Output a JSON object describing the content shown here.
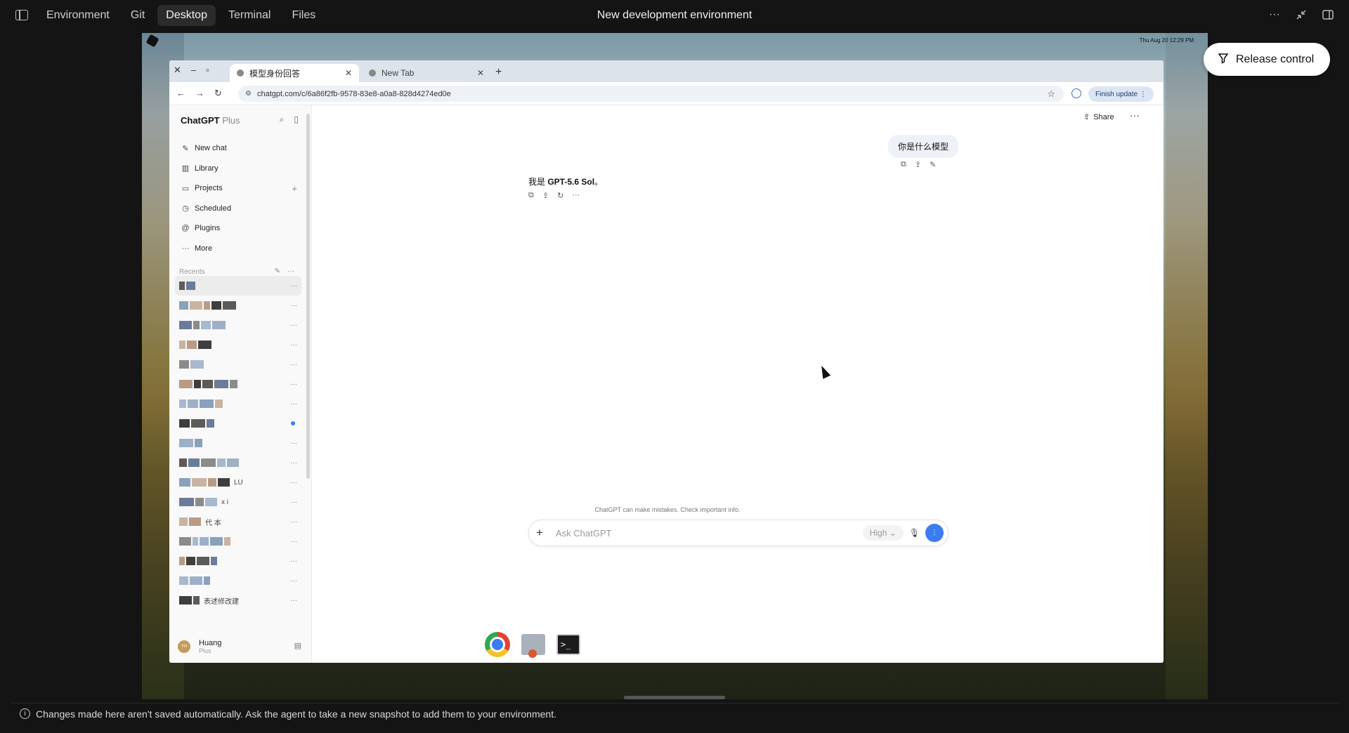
{
  "topbar": {
    "tabs": [
      {
        "label": "Environment"
      },
      {
        "label": "Git"
      },
      {
        "label": "Desktop"
      },
      {
        "label": "Terminal"
      },
      {
        "label": "Files"
      }
    ],
    "title": "New development environment",
    "more": "···",
    "collapse_icon": "collapse-icon",
    "panel_icon": "panel-icon"
  },
  "release": {
    "label": "Release control",
    "icon": "filter-icon"
  },
  "desktop": {
    "clock": "Thu Aug 20  12:29 PM"
  },
  "browser": {
    "tabs": [
      {
        "title": "模型身份回答"
      },
      {
        "title": "New Tab"
      }
    ],
    "url": "chatgpt.com/c/6a86f2fb-9578-83e8-a0a8-828d4274ed0e",
    "finish_update": "Finish update ⋮"
  },
  "chatgpt": {
    "brand": "ChatGPT",
    "plan_label": "Plus",
    "nav": [
      {
        "label": "New chat",
        "icon": "✎"
      },
      {
        "label": "Library",
        "icon": "▥"
      },
      {
        "label": "Projects",
        "icon": "▭"
      },
      {
        "label": "Scheduled",
        "icon": "◷"
      },
      {
        "label": "Plugins",
        "icon": "@"
      },
      {
        "label": "More",
        "icon": "···"
      }
    ],
    "section_label": "Recents",
    "chat_fragments": [
      "",
      "",
      "",
      "",
      "",
      "",
      "",
      "",
      "",
      "",
      "LU",
      "x i",
      "代 本",
      "",
      "",
      "",
      "表述修改建"
    ],
    "user": {
      "name": "Huang",
      "plan": "Plus",
      "initials": "YH"
    },
    "share": "Share",
    "user_message": "你是什么模型",
    "assistant_prefix": "我是 ",
    "assistant_bold": "GPT-5.6 Sol",
    "assistant_suffix": "。",
    "disclaimer": "ChatGPT can make mistakes. Check important info.",
    "composer": {
      "placeholder": "Ask ChatGPT",
      "level": "High ⌄"
    }
  },
  "footer": {
    "notice": "Changes made here aren't saved automatically. Ask the agent to take a new snapshot to add them to your environment."
  },
  "colors": {
    "accent": "#3b7cf0",
    "background": "#141414"
  }
}
